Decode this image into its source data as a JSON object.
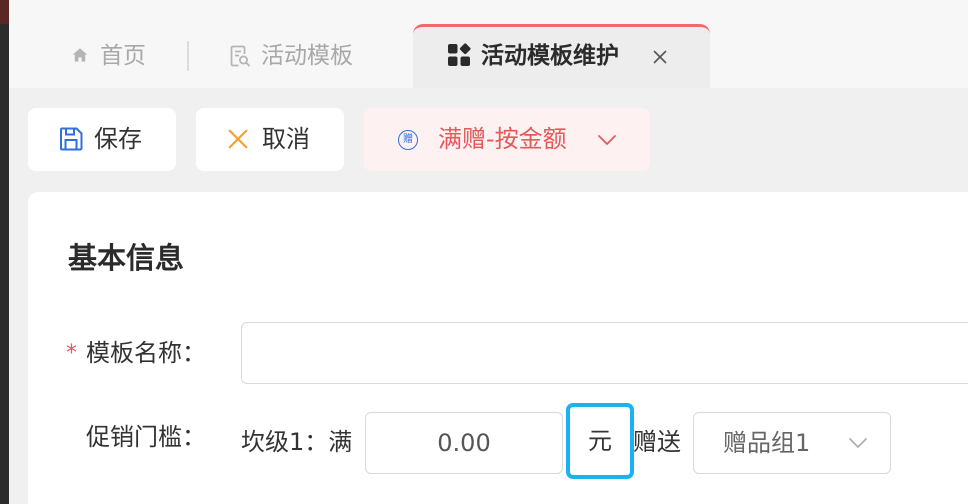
{
  "tabs": [
    {
      "label": "首页",
      "icon": "home-icon",
      "active": false
    },
    {
      "label": "活动模板",
      "icon": "document-search-icon",
      "active": false
    },
    {
      "label": "活动模板维护",
      "icon": "appstore-icon",
      "active": true,
      "closable": true
    }
  ],
  "toolbar": {
    "save": {
      "label": "保存",
      "icon": "save-icon"
    },
    "cancel": {
      "label": "取消",
      "icon": "close-icon"
    },
    "template_type": {
      "icon": "gift-badge-icon",
      "icon_text": "赠",
      "label": "满赠-按金额",
      "dropdown_icon": "chevron-down-icon"
    }
  },
  "section": {
    "title": "基本信息"
  },
  "form": {
    "template_name": {
      "required_mark": "*",
      "label": "模板名称：",
      "value": ""
    },
    "threshold": {
      "label": "促销门槛：",
      "tier_label": "坎级1：满",
      "amount": "0.00",
      "unit": "元",
      "gift_label": "赠送",
      "gift_group": "赠品组1"
    }
  },
  "colors": {
    "accent_red": "#e8585b",
    "primary_blue": "#2f6fde",
    "cancel_orange": "#f5a030",
    "focus_highlight": "#1ab2f5",
    "page_background": "#f0f0f0"
  }
}
